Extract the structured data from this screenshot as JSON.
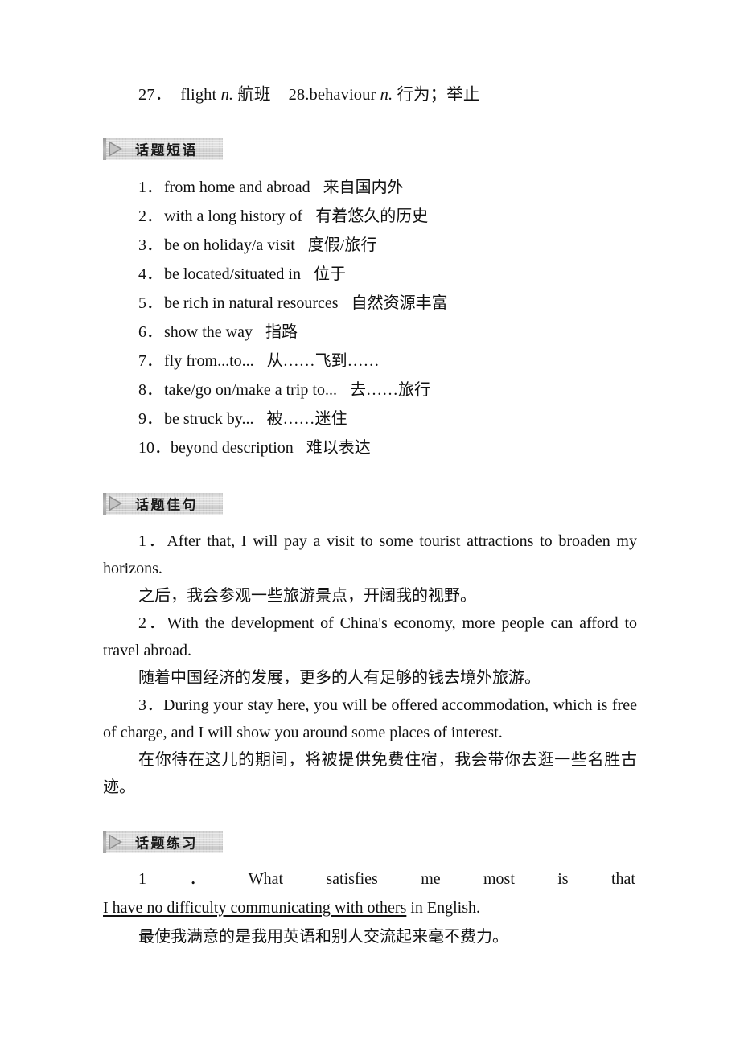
{
  "vocabulary": {
    "entries": [
      {
        "num": "27．",
        "word": "flight",
        "pos": "n.",
        "gloss": "航班"
      },
      {
        "num": "28.",
        "word": "behaviour",
        "pos": "n.",
        "gloss": "行为；举止"
      }
    ]
  },
  "sections": {
    "phrases": {
      "badge_label": "话题短语",
      "items": [
        {
          "num": "1．",
          "en": "from home and abroad",
          "zh": "来自国内外"
        },
        {
          "num": "2．",
          "en": "with a long history of",
          "zh": "有着悠久的历史"
        },
        {
          "num": "3．",
          "en": "be on holiday/a visit",
          "zh": "度假/旅行"
        },
        {
          "num": "4．",
          "en": "be located/situated in",
          "zh": "位于"
        },
        {
          "num": "5．",
          "en": "be rich in natural resources",
          "zh": "自然资源丰富"
        },
        {
          "num": "6．",
          "en": "show the way",
          "zh": "指路"
        },
        {
          "num": "7．",
          "en": "fly from...to...",
          "zh": "从……飞到……"
        },
        {
          "num": "8．",
          "en": "take/go on/make a trip to...",
          "zh": "去……旅行"
        },
        {
          "num": "9．",
          "en": "be struck by...",
          "zh": "被……迷住"
        },
        {
          "num": "10．",
          "en": "beyond description",
          "zh": "难以表达"
        }
      ]
    },
    "good_sentences": {
      "badge_label": "话题佳句",
      "items": [
        {
          "en": "1．After that, I will pay a visit to some tourist attractions to broaden my horizons.",
          "zh": "之后，我会参观一些旅游景点，开阔我的视野。"
        },
        {
          "en": "2．With the development of China's economy, more people can afford to travel abroad.",
          "zh": "随着中国经济的发展，更多的人有足够的钱去境外旅游。"
        },
        {
          "en": "3．During your stay here, you will be offered accommodation, which is free of charge, and I will show you around some places of interest.",
          "zh": "在你待在这儿的期间，将被提供免费住宿，我会带你去逛一些名胜古迹。"
        }
      ]
    },
    "practice": {
      "badge_label": "话题练习",
      "item": {
        "line1_tokens": [
          "1",
          "．",
          "What",
          "satisfies",
          "me",
          "most",
          "is",
          "that"
        ],
        "answer": "I have no difficulty communicating with others",
        "tail": " in English.",
        "zh": "最使我满意的是我用英语和别人交流起来毫不费力。"
      }
    }
  },
  "icons": {
    "badge_arrow": "triangle-right-icon"
  },
  "colors": {
    "page_background": "#ffffff",
    "text": "#111111",
    "badge_gradient_start": "#d2d2d2",
    "badge_gradient_end": "#dedede",
    "badge_arrow": "#8f8f8f"
  }
}
